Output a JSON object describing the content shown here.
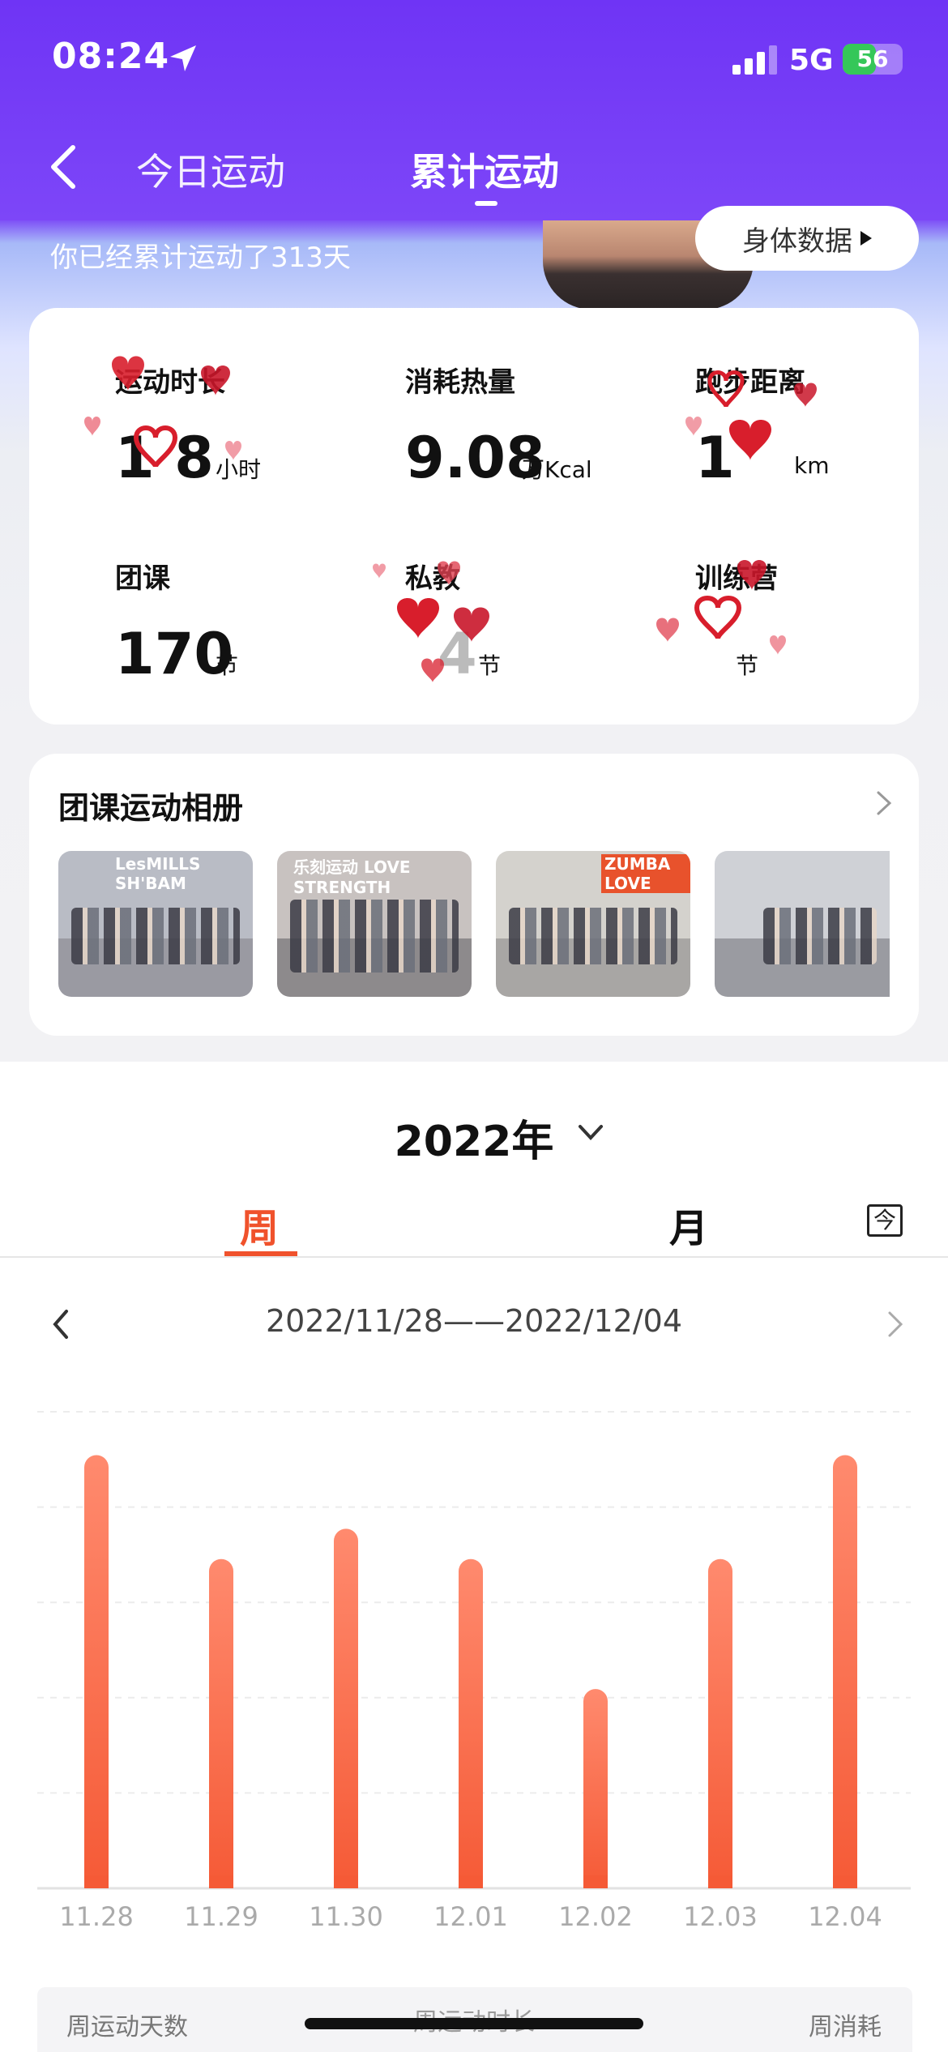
{
  "status_bar": {
    "time": "08:24",
    "network": "5G",
    "battery": "56",
    "battery_level": 0.56
  },
  "nav": {
    "tabs": [
      {
        "label": "今日运动",
        "active": false
      },
      {
        "label": "累计运动",
        "active": true
      }
    ]
  },
  "banner": {
    "text": "你已经累计运动了313天",
    "body_data_button": "身体数据"
  },
  "stats": [
    {
      "label": "运动时长",
      "value": "1 8",
      "unit": "小时",
      "obscured": true
    },
    {
      "label": "消耗热量",
      "value": "9.08",
      "unit": "万Kcal",
      "obscured": false
    },
    {
      "label": "跑步距离",
      "value": "1",
      "unit": "km",
      "obscured": true
    },
    {
      "label": "团课",
      "value": "170",
      "unit": "节",
      "obscured": false
    },
    {
      "label": "私教",
      "value": "4",
      "unit": "节",
      "obscured": true
    },
    {
      "label": "训练营",
      "value": "",
      "unit": "节",
      "obscured": true
    }
  ],
  "album": {
    "title": "团课运动相册",
    "photos": [
      {
        "caption": "LesMILLS SH'BAM"
      },
      {
        "caption": "乐刻运动 LOVE STRENGTH"
      },
      {
        "caption": "ZUMBA LOVE"
      },
      {
        "caption": ""
      }
    ]
  },
  "year_selector": {
    "label": "2022年"
  },
  "period_tabs": {
    "week": "周",
    "month": "月",
    "today": "今"
  },
  "range": {
    "label": "2022/11/28——2022/12/04"
  },
  "colors": {
    "accent": "#f0522c",
    "header": "#7b44f7",
    "bar_top": "#ff8a6e",
    "bar_bottom": "#f55a36"
  },
  "chart_data": {
    "type": "bar",
    "categories": [
      "11.28",
      "11.29",
      "11.30",
      "12.01",
      "12.02",
      "12.03",
      "12.04"
    ],
    "values": [
      100,
      76,
      83,
      76,
      46,
      76,
      100
    ],
    "ylim": [
      0,
      110
    ],
    "grid": true
  },
  "summary": {
    "labels": [
      "周运动天数",
      "周运动时长",
      "周消耗"
    ]
  }
}
